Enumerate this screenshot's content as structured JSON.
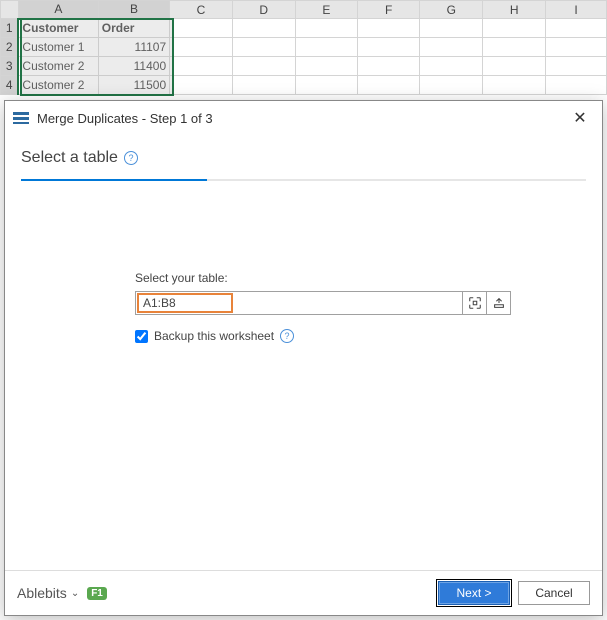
{
  "sheet": {
    "columns": [
      "A",
      "B",
      "C",
      "D",
      "E",
      "F",
      "G",
      "H",
      "I"
    ],
    "rows": [
      {
        "n": "1",
        "a": "Customer",
        "b": "Order",
        "header": true
      },
      {
        "n": "2",
        "a": "Customer 1",
        "b": "11107"
      },
      {
        "n": "3",
        "a": "Customer 2",
        "b": "11400"
      },
      {
        "n": "4",
        "a": "Customer 2",
        "b": "11500"
      }
    ]
  },
  "dialog": {
    "title": "Merge Duplicates - Step 1 of 3",
    "heading": "Select a table",
    "select_label": "Select your table:",
    "range_value": "A1:B8",
    "backup_label": "Backup this worksheet",
    "brand": "Ablebits",
    "f1": "F1",
    "next": "Next >",
    "cancel": "Cancel",
    "help": "?"
  }
}
